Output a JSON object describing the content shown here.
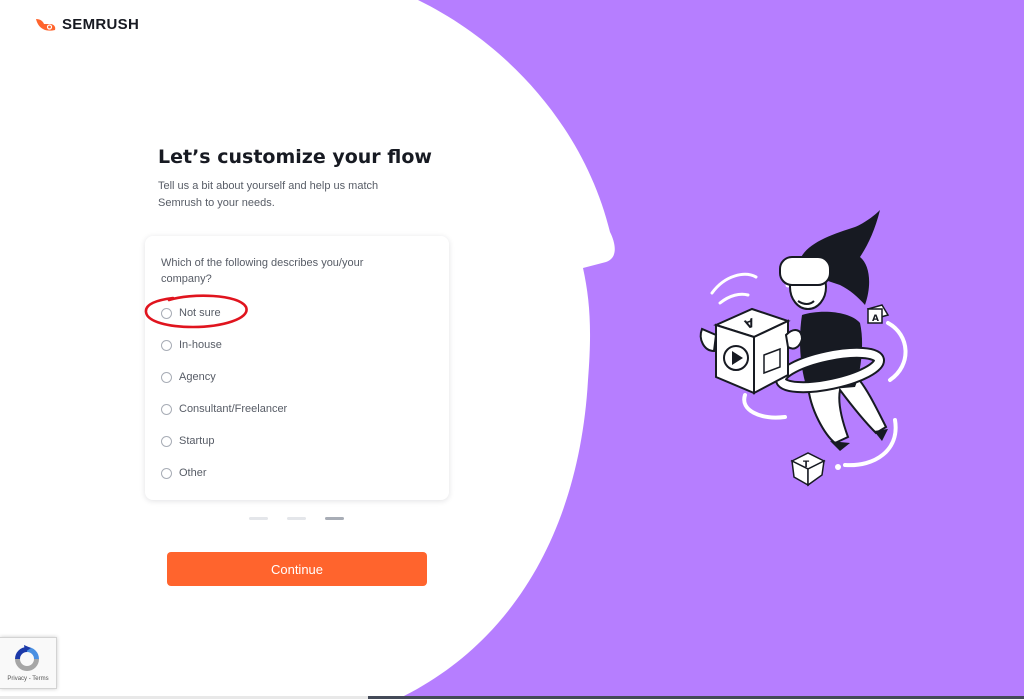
{
  "brand": {
    "name": "SEMRUSH",
    "accent_color": "#ff642d",
    "panel_color": "#b67eff"
  },
  "onboarding": {
    "title": "Let’s customize your flow",
    "subtitle": "Tell us a bit about yourself and help us match Semrush to your needs.",
    "question": "Which of the following describes you/your company?",
    "options": [
      {
        "label": "Not sure",
        "selected": false
      },
      {
        "label": "In-house",
        "selected": false
      },
      {
        "label": "Agency",
        "selected": false
      },
      {
        "label": "Consultant/Freelancer",
        "selected": false
      },
      {
        "label": "Startup",
        "selected": false
      },
      {
        "label": "Other",
        "selected": false
      }
    ],
    "steps": {
      "total": 3,
      "current": 3
    },
    "continue_label": "Continue"
  },
  "annotation": {
    "color": "#e0141e",
    "target": "Not sure"
  },
  "recaptcha": {
    "footer": "Privacy - Terms"
  },
  "illustration": {
    "cube_letters": [
      "A",
      "A",
      "T"
    ],
    "icon": "play-icon"
  }
}
